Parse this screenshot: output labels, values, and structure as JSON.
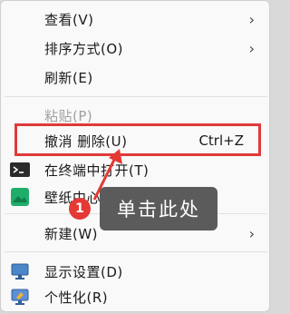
{
  "menu": {
    "items": [
      {
        "label": "查看(V)",
        "has_submenu": true
      },
      {
        "label": "排序方式(O)",
        "has_submenu": true
      },
      {
        "label": "刷新(E)"
      },
      {
        "label": "粘贴(P)",
        "disabled": true
      },
      {
        "label": "撤消 删除(U)",
        "shortcut": "Ctrl+Z"
      },
      {
        "label": "在终端中打开(T)",
        "icon": "terminal-icon"
      },
      {
        "label": "壁纸中心",
        "icon": "wallpaper-icon"
      },
      {
        "label": "新建(W)",
        "has_submenu": true
      },
      {
        "label": "显示设置(D)",
        "icon": "display-icon"
      },
      {
        "label": "个性化(R)",
        "icon": "personalize-icon"
      }
    ],
    "chevron": "›"
  },
  "annotation": {
    "badge_number": "1",
    "tooltip_text": "单击此处",
    "highlight_color": "#e03a3a",
    "badge_color": "#e53935",
    "tooltip_bg": "#5b5b5b"
  }
}
